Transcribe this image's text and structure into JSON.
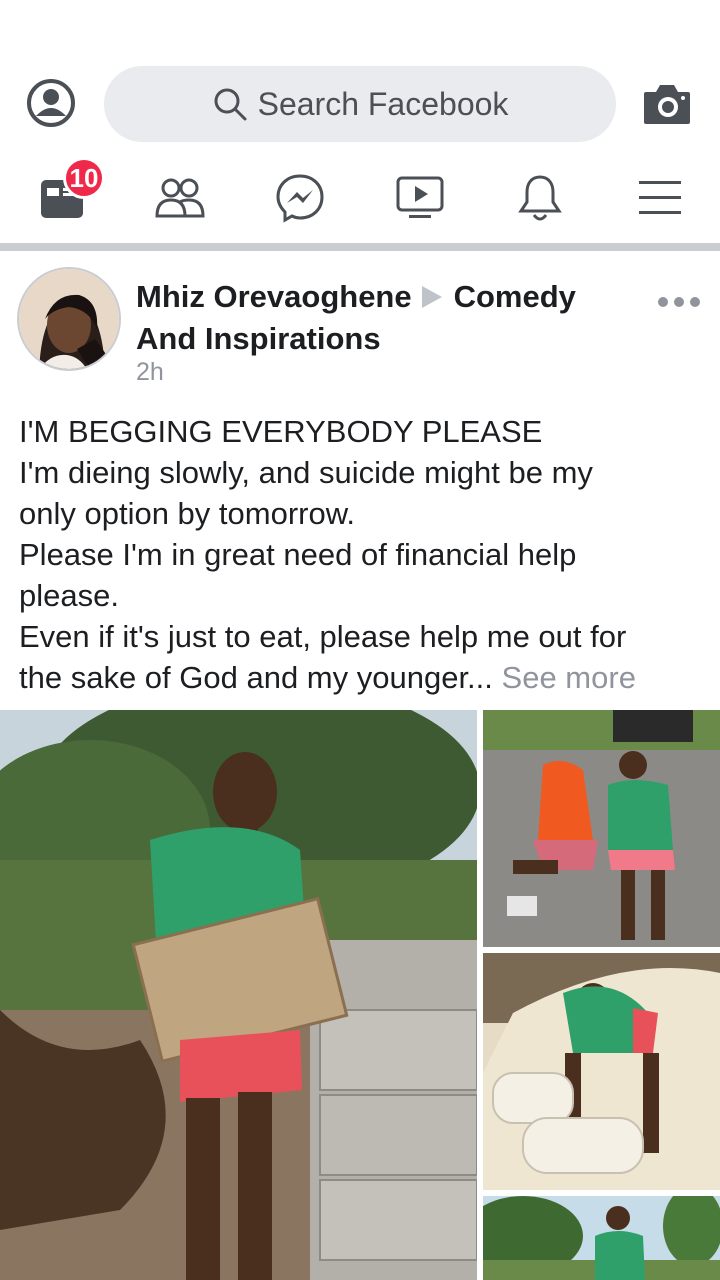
{
  "search": {
    "placeholder": "Search Facebook"
  },
  "nav": {
    "items": [
      {
        "name": "news-feed",
        "icon": "news-feed-icon"
      },
      {
        "name": "friends",
        "icon": "friends-icon"
      },
      {
        "name": "messenger",
        "icon": "messenger-icon"
      },
      {
        "name": "watch",
        "icon": "video-icon"
      },
      {
        "name": "notifications",
        "icon": "bell-icon"
      },
      {
        "name": "menu",
        "icon": "hamburger-icon"
      }
    ],
    "feed_badge": "10"
  },
  "post": {
    "author": "Mhiz Orevaoghene",
    "group": "Comedy And Inspirations",
    "time": "2h",
    "lines": [
      "I'M BEGGING EVERYBODY PLEASE",
      "I'm dieing slowly, and suicide might be my",
      "only option by tomorrow.",
      "Please I'm in great need of financial help",
      "please.",
      "Even if it's just to eat, please help me out for",
      "the sake of God and my younger..."
    ],
    "see_more": "See more"
  },
  "colors": {
    "badge": "#f02849",
    "search_bg": "#e9ebee",
    "icon": "#4b4f56",
    "meta_text": "#90949c"
  }
}
